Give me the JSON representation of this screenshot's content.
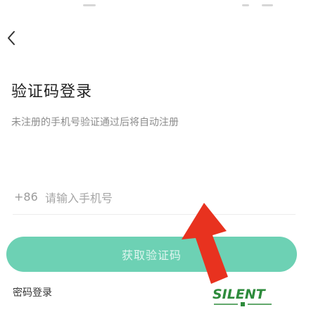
{
  "header": {
    "back_icon": "chevron-left-icon"
  },
  "login": {
    "title": "验证码登录",
    "subtitle": "未注册的手机号验证通过后将自动注册",
    "country_code": "+86",
    "phone_placeholder": "请输入手机号",
    "get_code_label": "获取验证码",
    "password_login_label": "密码登录"
  },
  "annotation": {
    "arrow_icon": "red-arrow-icon",
    "arrow_color": "#e8321f"
  },
  "watermark": {
    "text": "SILENT",
    "color": "#2e8b3c"
  },
  "colors": {
    "accent": "#6dd1b4",
    "title_text": "#222222",
    "hint_text": "#8c8c8c"
  }
}
